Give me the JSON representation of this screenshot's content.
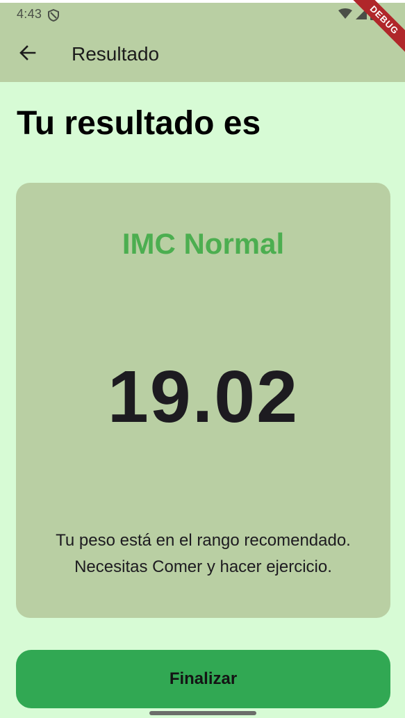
{
  "status_bar": {
    "time": "4:43"
  },
  "debug_banner": "DEBUG",
  "app_bar": {
    "title": "Resultado"
  },
  "page": {
    "heading": "Tu resultado es"
  },
  "result_card": {
    "category": "IMC Normal",
    "value": "19.02",
    "message": "Tu peso está en el rango recomendado. Necesitas Comer y hacer ejercicio."
  },
  "actions": {
    "finish_label": "Finalizar"
  },
  "colors": {
    "background": "#d7fbd5",
    "bar": "#b9cfa3",
    "card": "#b9cfa3",
    "category_text": "#4cae50",
    "button": "#31a853"
  },
  "icons": {
    "back": "arrow-left-icon",
    "shield": "shield-icon",
    "wifi": "wifi-icon",
    "signal": "cell-signal-icon",
    "battery": "battery-icon"
  }
}
